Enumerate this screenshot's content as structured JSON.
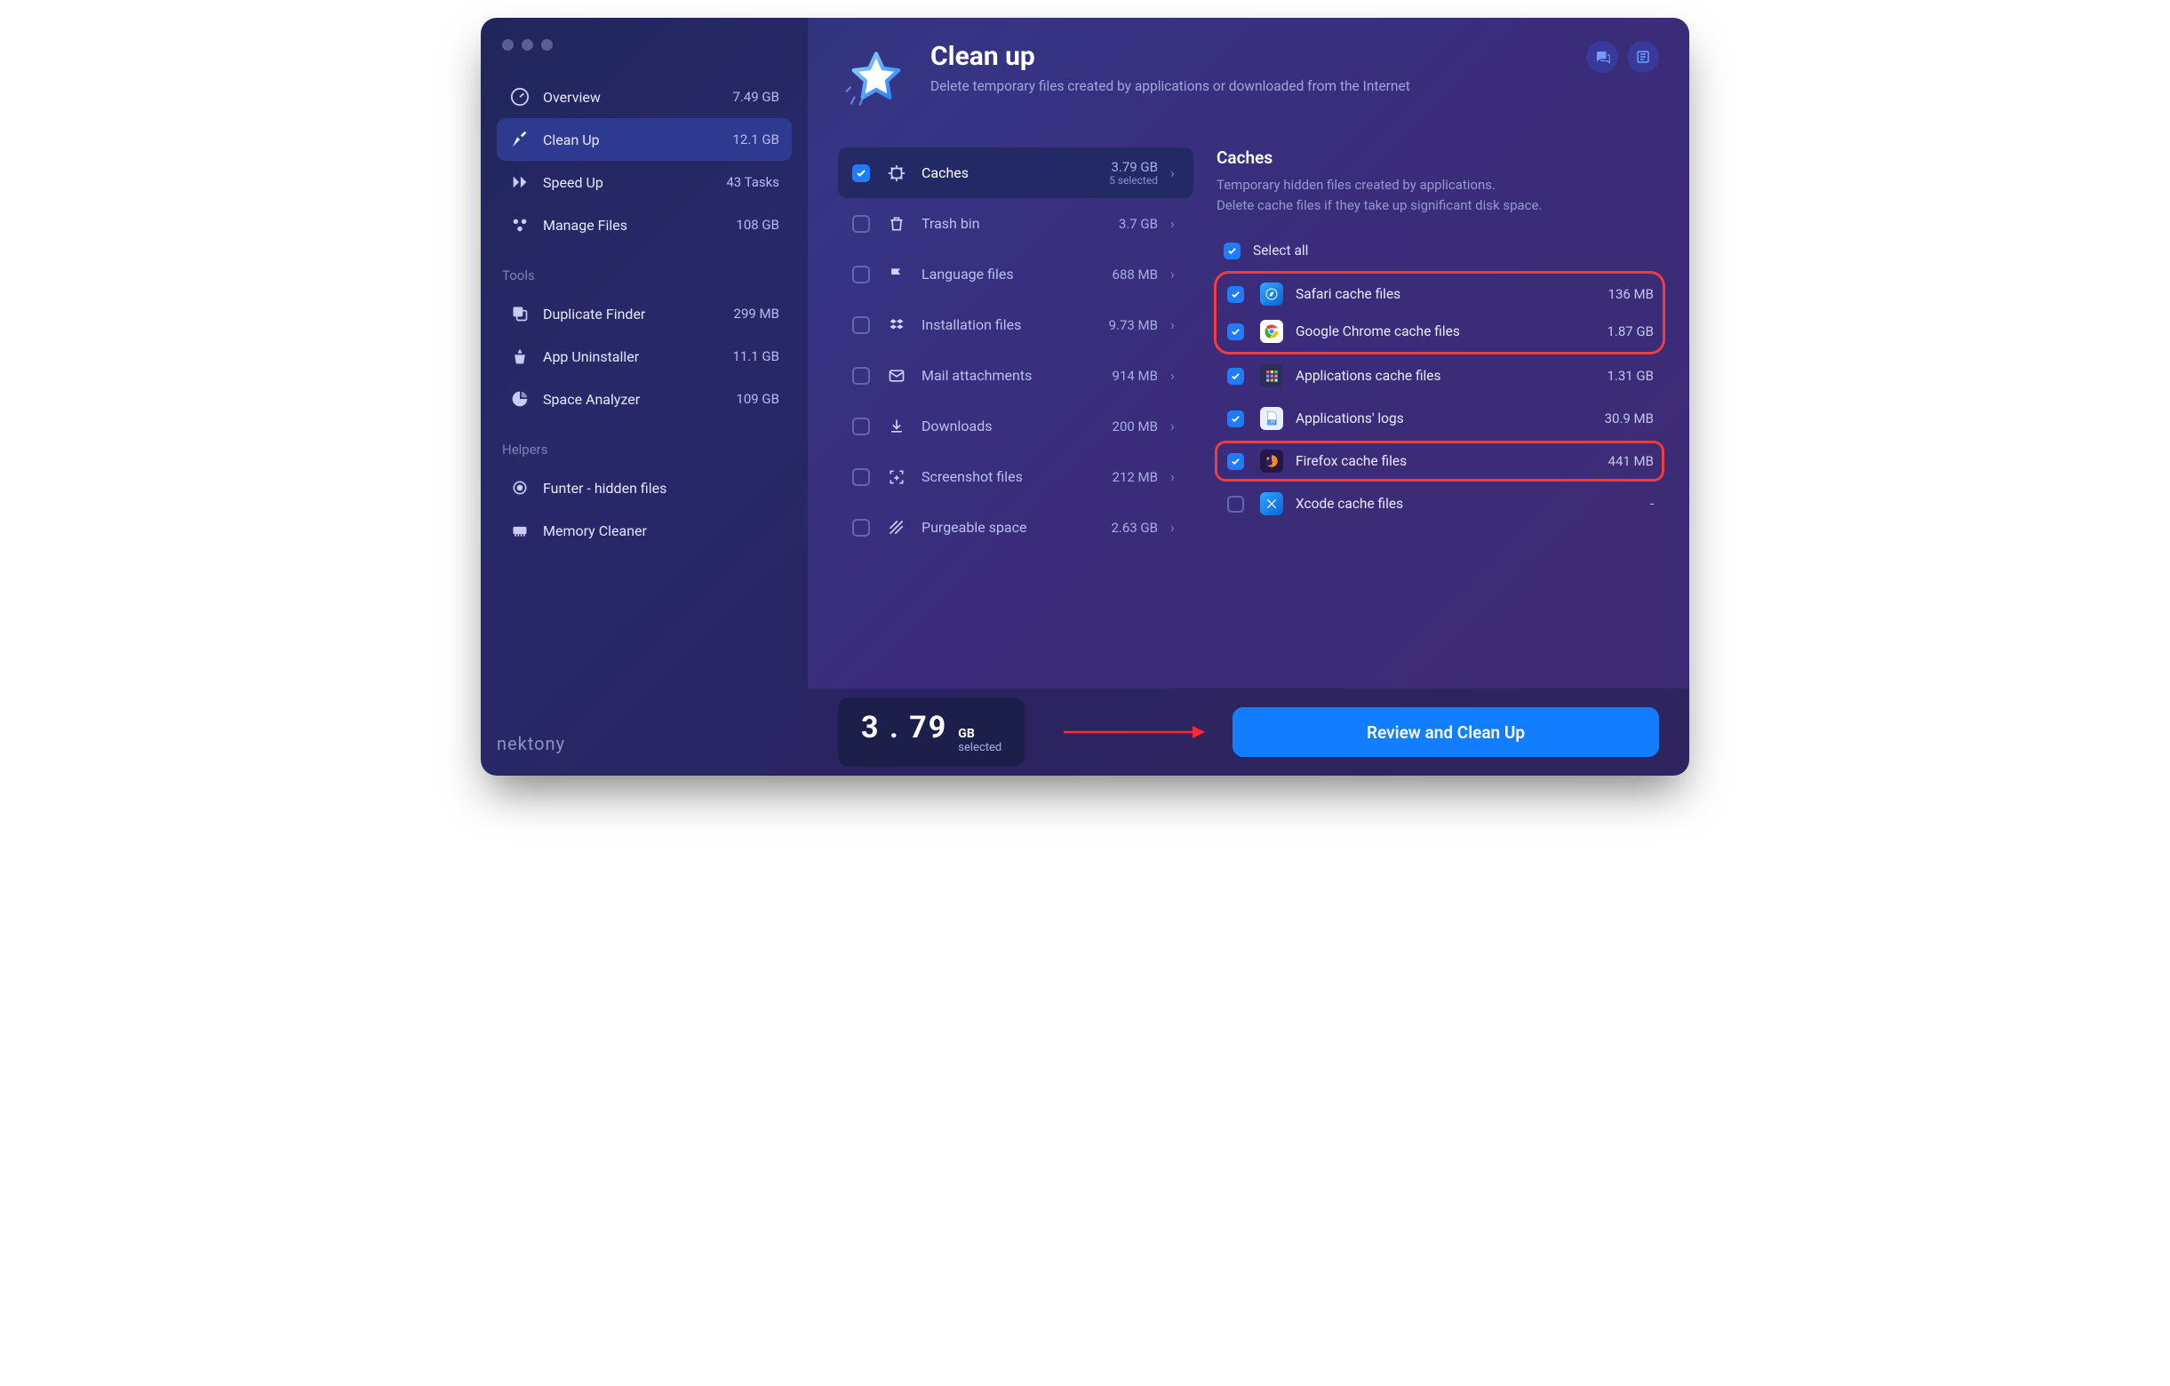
{
  "sidebar": {
    "items": [
      {
        "label": "Overview",
        "value": "7.49 GB"
      },
      {
        "label": "Clean Up",
        "value": "12.1 GB"
      },
      {
        "label": "Speed Up",
        "value": "43 Tasks"
      },
      {
        "label": "Manage Files",
        "value": "108 GB"
      }
    ],
    "tools_header": "Tools",
    "tools": [
      {
        "label": "Duplicate Finder",
        "value": "299 MB"
      },
      {
        "label": "App Uninstaller",
        "value": "11.1 GB"
      },
      {
        "label": "Space Analyzer",
        "value": "109 GB"
      }
    ],
    "helpers_header": "Helpers",
    "helpers": [
      {
        "label": "Funter - hidden files",
        "value": ""
      },
      {
        "label": "Memory Cleaner",
        "value": ""
      }
    ],
    "brand": "nektony"
  },
  "header": {
    "title": "Clean up",
    "subtitle": "Delete temporary files created by applications or downloaded from the Internet"
  },
  "categories": [
    {
      "name": "Caches",
      "size": "3.79 GB",
      "sub": "5 selected",
      "checked": true,
      "active": true
    },
    {
      "name": "Trash bin",
      "size": "3.7 GB",
      "checked": false
    },
    {
      "name": "Language files",
      "size": "688 MB",
      "checked": false
    },
    {
      "name": "Installation files",
      "size": "9.73 MB",
      "checked": false
    },
    {
      "name": "Mail attachments",
      "size": "914 MB",
      "checked": false
    },
    {
      "name": "Downloads",
      "size": "200 MB",
      "checked": false
    },
    {
      "name": "Screenshot files",
      "size": "212 MB",
      "checked": false
    },
    {
      "name": "Purgeable space",
      "size": "2.63 GB",
      "checked": false
    }
  ],
  "detail": {
    "title": "Caches",
    "desc_l1": "Temporary hidden files created by applications.",
    "desc_l2": "Delete cache files if they take up significant disk space.",
    "select_all": "Select all",
    "files": [
      {
        "name": "Safari cache files",
        "size": "136 MB",
        "checked": true
      },
      {
        "name": "Google Chrome cache files",
        "size": "1.87 GB",
        "checked": true
      },
      {
        "name": "Applications cache files",
        "size": "1.31 GB",
        "checked": true
      },
      {
        "name": "Applications' logs",
        "size": "30.9 MB",
        "checked": true
      },
      {
        "name": "Firefox cache files",
        "size": "441 MB",
        "checked": true
      },
      {
        "name": "Xcode cache files",
        "size": "-",
        "checked": false
      }
    ]
  },
  "footer": {
    "amount": "3 . 79",
    "unit": "GB",
    "label": "selected",
    "button": "Review and Clean Up"
  }
}
